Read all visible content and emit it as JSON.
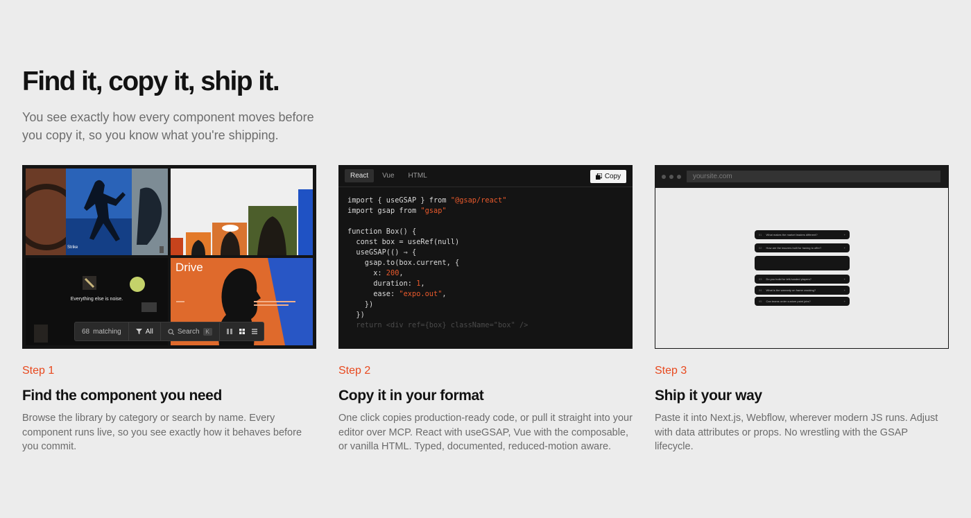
{
  "hero": {
    "title": "Find it, copy it, ship it.",
    "subtitle": "You see exactly how every component moves before you copy it, so you know what you're shipping."
  },
  "card1": {
    "tile_labels": {
      "strike": "Strike",
      "tagline": "Everything else is noise.",
      "drive": "Drive"
    },
    "toolbar": {
      "count": "68",
      "matching": "matching",
      "filter": "All",
      "search": "Search",
      "shortcut": "K"
    }
  },
  "card2": {
    "tabs": [
      "React",
      "Vue",
      "HTML"
    ],
    "copy_label": "Copy",
    "code_lines": [
      "import { useGSAP } from ",
      "\"@gsap/react\"",
      "import gsap from ",
      "\"gsap\"",
      "function Box() {",
      "  const box = useRef(null)",
      "  useGSAP(() ⇒ {",
      "    gsap.to(box.current, {",
      "      x: ",
      "200",
      "      duration: ",
      "1",
      "      ease: ",
      "\"expo.out\"",
      "    })",
      "  })",
      "  return <div ref={box} className=\"box\" />"
    ]
  },
  "card3": {
    "url": "yoursite.com",
    "faq_items": [
      "What makes the market leaders different?",
      "How are the insurers built for having to offer?",
      "Do you build for left-handed players?",
      "What is the warranty on frame cracking?",
      "Can teams order custom paint jobs?"
    ]
  },
  "steps": [
    {
      "label": "Step 1",
      "title": "Find the component you need",
      "body": "Browse the library by category or search by name. Every component runs live, so you see exactly how it behaves before you commit."
    },
    {
      "label": "Step 2",
      "title": "Copy it in your format",
      "body": "One click copies production-ready code, or pull it straight into your editor over MCP. React with useGSAP, Vue with the composable, or vanilla HTML. Typed, documented, reduced-motion aware."
    },
    {
      "label": "Step 3",
      "title": "Ship it your way",
      "body": "Paste it into Next.js, Webflow, wherever modern JS runs. Adjust with data attributes or props. No wrestling with the GSAP lifecycle."
    }
  ],
  "colors": {
    "accent": "#e8481d",
    "background": "#ececec",
    "card_dark": "#141414"
  }
}
